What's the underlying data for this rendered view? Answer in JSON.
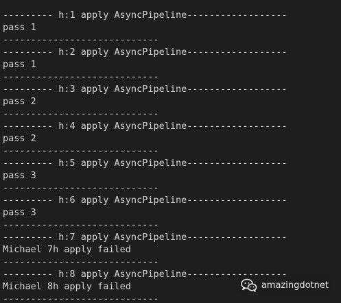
{
  "terminal": {
    "lines": [
      "--------- h:1 apply AsyncPipeline------------------",
      "pass 1",
      "----------------------------",
      "--------- h:2 apply AsyncPipeline------------------",
      "pass 1",
      "----------------------------",
      "--------- h:3 apply AsyncPipeline------------------",
      "pass 2",
      "----------------------------",
      "--------- h:4 apply AsyncPipeline------------------",
      "pass 2",
      "----------------------------",
      "--------- h:5 apply AsyncPipeline------------------",
      "pass 3",
      "----------------------------",
      "--------- h:6 apply AsyncPipeline------------------",
      "pass 3",
      "----------------------------",
      "--------- h:7 apply AsyncPipeline------------------",
      "Michael 7h apply failed",
      "----------------------------",
      "--------- h:8 apply AsyncPipeline------------------",
      "Michael 8h apply failed",
      "----------------------------"
    ]
  },
  "watermark": {
    "icon": "wechat-icon",
    "text": "amazingdotnet"
  },
  "colors": {
    "background": "#1e1e1e",
    "text": "#d4d4d4"
  }
}
